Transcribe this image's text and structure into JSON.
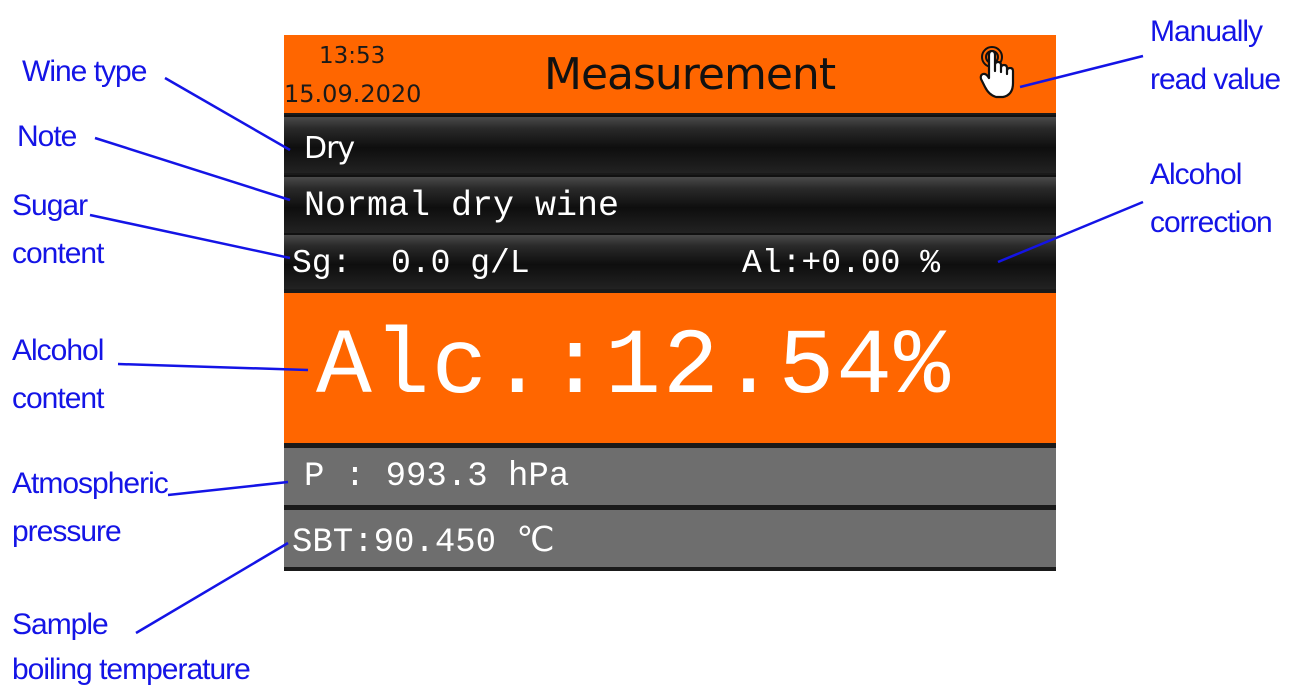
{
  "header": {
    "time": "13:53",
    "date": "15.09.2020",
    "title": "Measurement",
    "icon": "hand-pointer-icon"
  },
  "wine_type": "Dry",
  "note": "Normal dry wine",
  "sugar": "Sg:  0.0 g/L",
  "alcohol_correction": "Al:+0.00 %",
  "alcohol": "Alc.:12.54%",
  "pressure": "P : 993.3 hPa",
  "sbt": "SBT:90.450 ℃",
  "annotations": {
    "wine_type": "Wine type",
    "note": "Note",
    "sugar_1": "Sugar",
    "sugar_2": "content",
    "alcohol_1": "Alcohol",
    "alcohol_2": "content",
    "pressure_1": "Atmospheric",
    "pressure_2": "pressure",
    "sample_1": "Sample",
    "sample_2": "boiling temperature",
    "manual_1": "Manually",
    "manual_2": "read value",
    "correction_1": "Alcohol",
    "correction_2": "correction"
  },
  "colors": {
    "accent": "#ff6600",
    "annotation": "#1414e6",
    "panel_gray": "#6e6e6e",
    "panel_dark": "#0e0e0e"
  }
}
